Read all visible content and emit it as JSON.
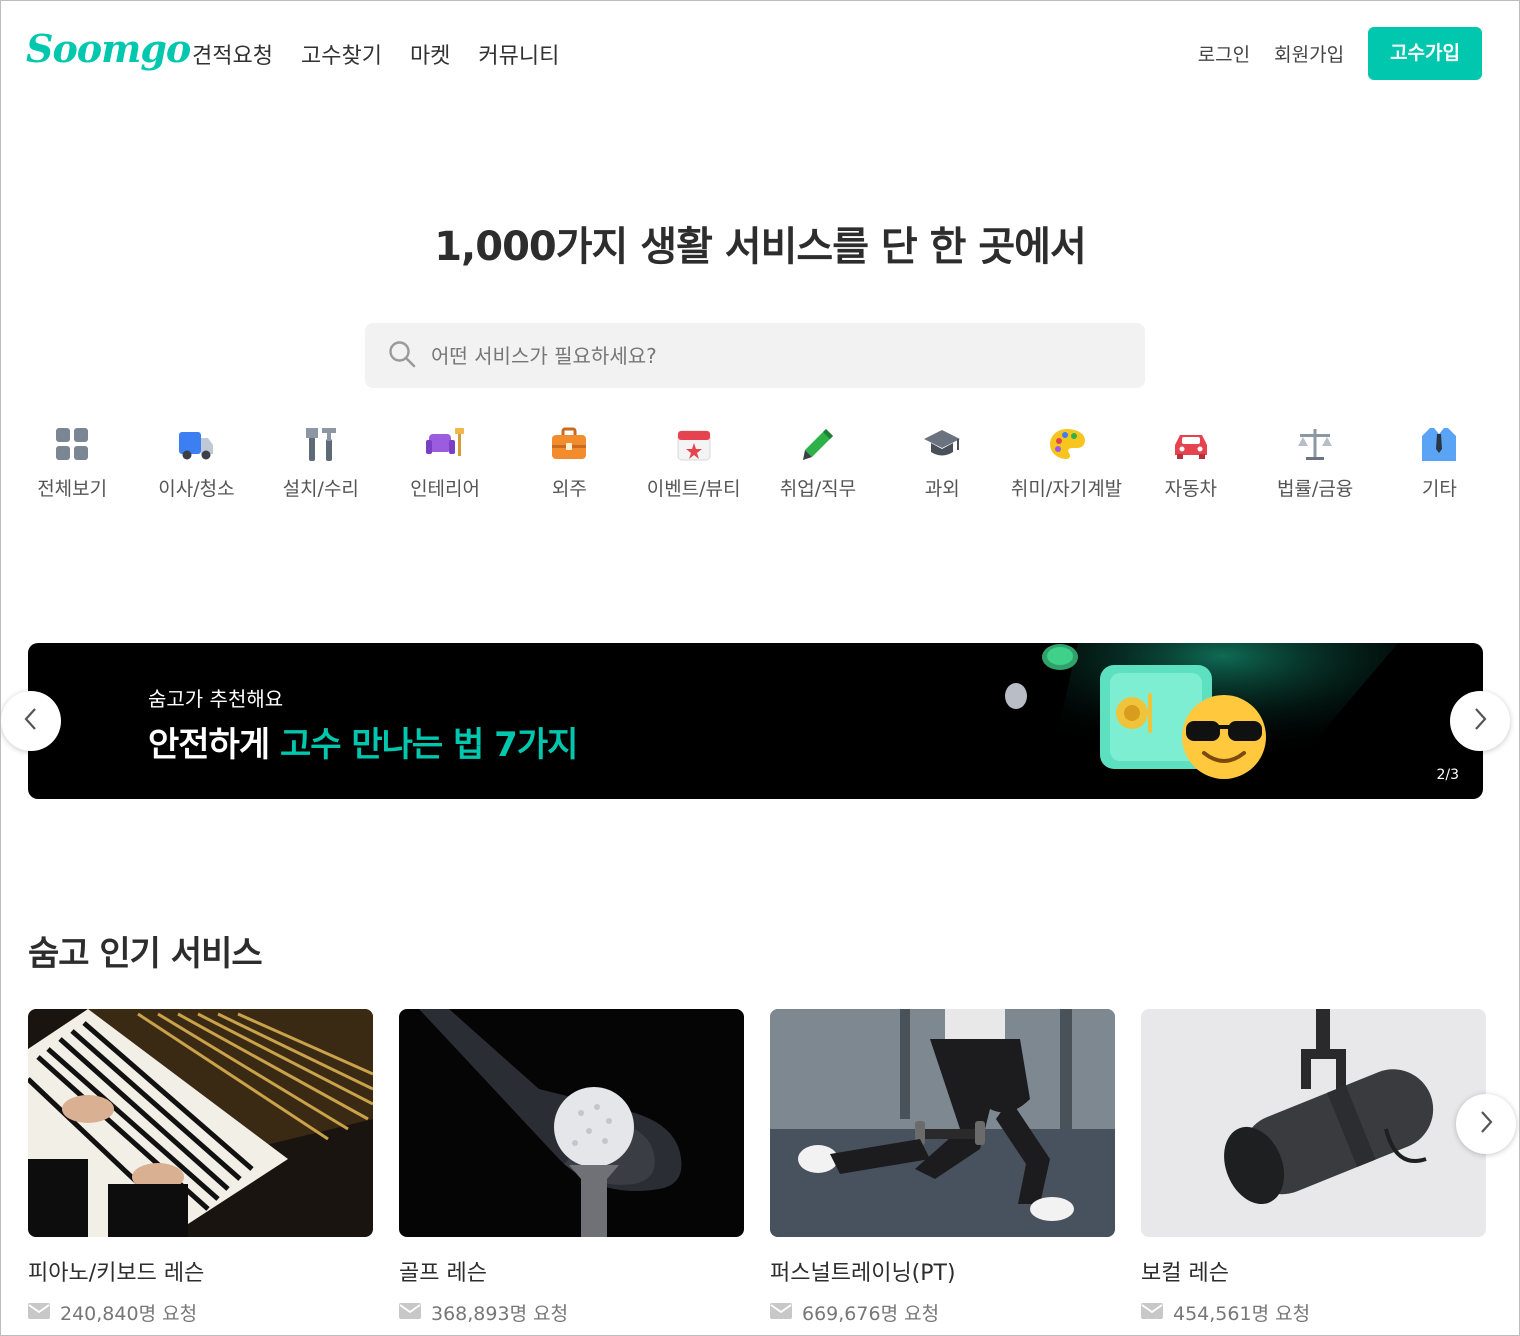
{
  "header": {
    "logo": "Soomgo",
    "nav": [
      "견적요청",
      "고수찾기",
      "마켓",
      "커뮤니티"
    ],
    "login": "로그인",
    "signup": "회원가입",
    "pro_signup": "고수가입"
  },
  "hero": {
    "title": "1,000가지 생활 서비스를 단 한 곳에서",
    "search_placeholder": "어떤 서비스가 필요하세요?"
  },
  "categories": [
    {
      "label": "전체보기",
      "icon": "grid-icon"
    },
    {
      "label": "이사/청소",
      "icon": "truck-icon"
    },
    {
      "label": "설치/수리",
      "icon": "tools-icon"
    },
    {
      "label": "인테리어",
      "icon": "sofa-icon"
    },
    {
      "label": "외주",
      "icon": "briefcase-icon"
    },
    {
      "label": "이벤트/뷰티",
      "icon": "calendar-icon"
    },
    {
      "label": "취업/직무",
      "icon": "pencil-icon"
    },
    {
      "label": "과외",
      "icon": "graduation-cap-icon"
    },
    {
      "label": "취미/자기계발",
      "icon": "palette-icon"
    },
    {
      "label": "자동차",
      "icon": "car-icon"
    },
    {
      "label": "법률/금융",
      "icon": "scales-icon"
    },
    {
      "label": "기타",
      "icon": "shirt-icon"
    }
  ],
  "banner": {
    "subtitle": "숨고가 추천해요",
    "title_prefix": "안전하게 ",
    "title_highlight": "고수 만나는 법 7가지",
    "pager": "2/3"
  },
  "popular": {
    "title": "숨고 인기 서비스",
    "items": [
      {
        "name": "피아노/키보드 레슨",
        "requests": "240,840명 요청"
      },
      {
        "name": "골프 레슨",
        "requests": "368,893명 요청"
      },
      {
        "name": "퍼스널트레이닝(PT)",
        "requests": "669,676명 요청"
      },
      {
        "name": "보컬 레슨",
        "requests": "454,561명 요청"
      }
    ]
  },
  "colors": {
    "brand": "#00c7ae",
    "text": "#323232",
    "muted": "#777777"
  }
}
